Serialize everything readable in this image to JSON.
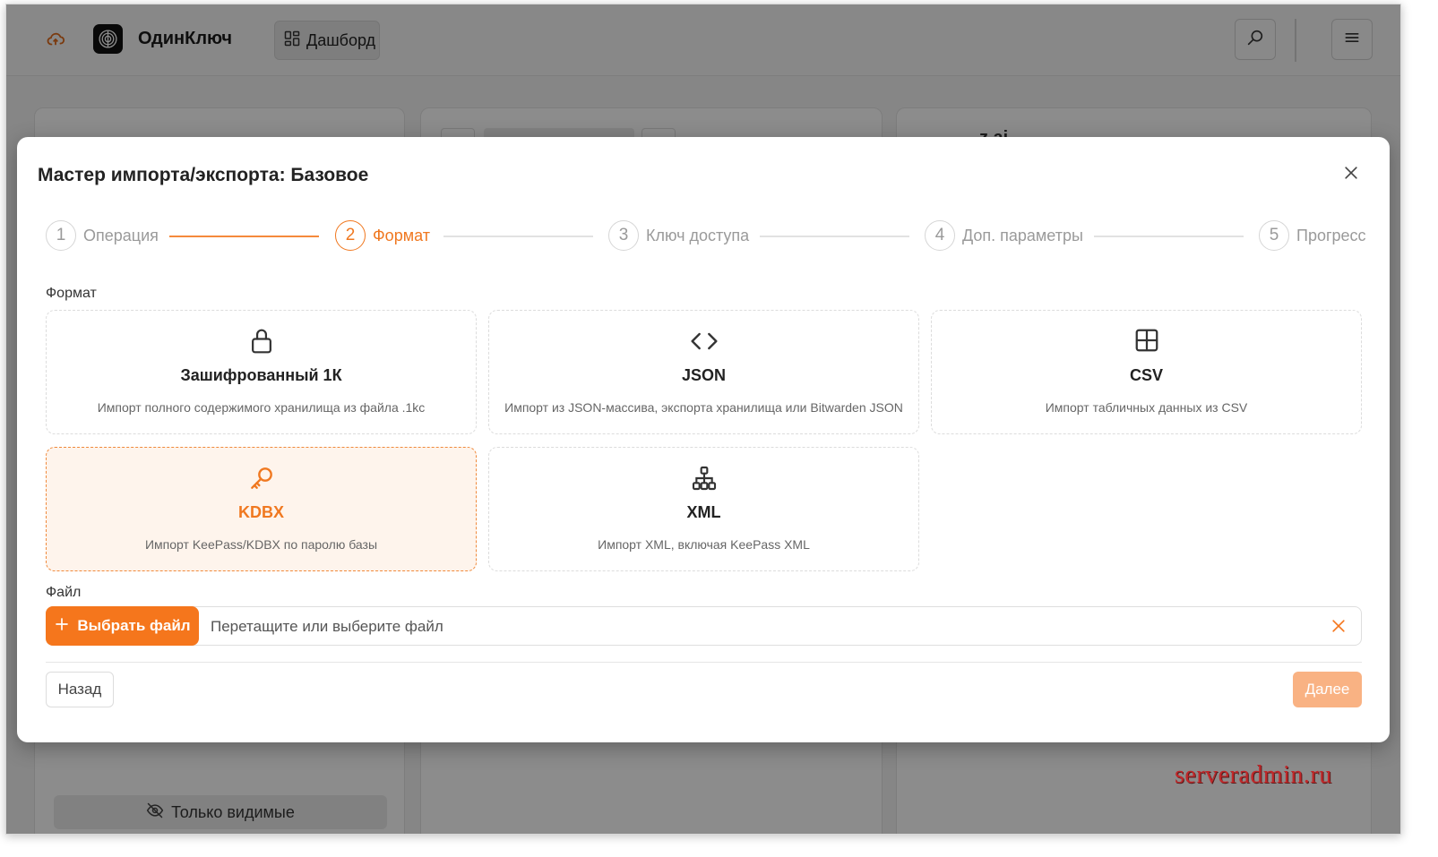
{
  "app": {
    "name": "ОдинКлюч",
    "dashboard_label": "Дашборд",
    "visible_only_label": "Только видимые",
    "peek_text": "z ai"
  },
  "watermark": "serveradmin.ru",
  "modal": {
    "title": "Мастер импорта/экспорта: Базовое",
    "steps": [
      {
        "num": "1",
        "label": "Операция"
      },
      {
        "num": "2",
        "label": "Формат"
      },
      {
        "num": "3",
        "label": "Ключ доступа"
      },
      {
        "num": "4",
        "label": "Доп. параметры"
      },
      {
        "num": "5",
        "label": "Прогресс"
      }
    ],
    "active_step": 2,
    "format_label": "Формат",
    "formats": [
      {
        "title": "Зашифрованный 1К",
        "desc": "Импорт полного содержимого хранилища из файла .1kc",
        "icon": "lock-icon"
      },
      {
        "title": "JSON",
        "desc": "Импорт из JSON-массива, экспорта хранилища или Bitwarden JSON",
        "icon": "code-icon"
      },
      {
        "title": "CSV",
        "desc": "Импорт табличных данных из CSV",
        "icon": "table-icon"
      },
      {
        "title": "KDBX",
        "desc": "Импорт KeePass/KDBX по паролю базы",
        "icon": "key-icon"
      },
      {
        "title": "XML",
        "desc": "Импорт XML, включая KeePass XML",
        "icon": "sitemap-icon"
      }
    ],
    "selected_format": "KDBX",
    "file_label": "Файл",
    "file_button": "Выбрать файл",
    "file_placeholder": "Перетащите или выберите файл",
    "back_button": "Назад",
    "next_button": "Далее"
  },
  "colors": {
    "accent": "#f5761c",
    "accent_light": "#fef4ec",
    "disabled_accent": "#f9b283"
  }
}
